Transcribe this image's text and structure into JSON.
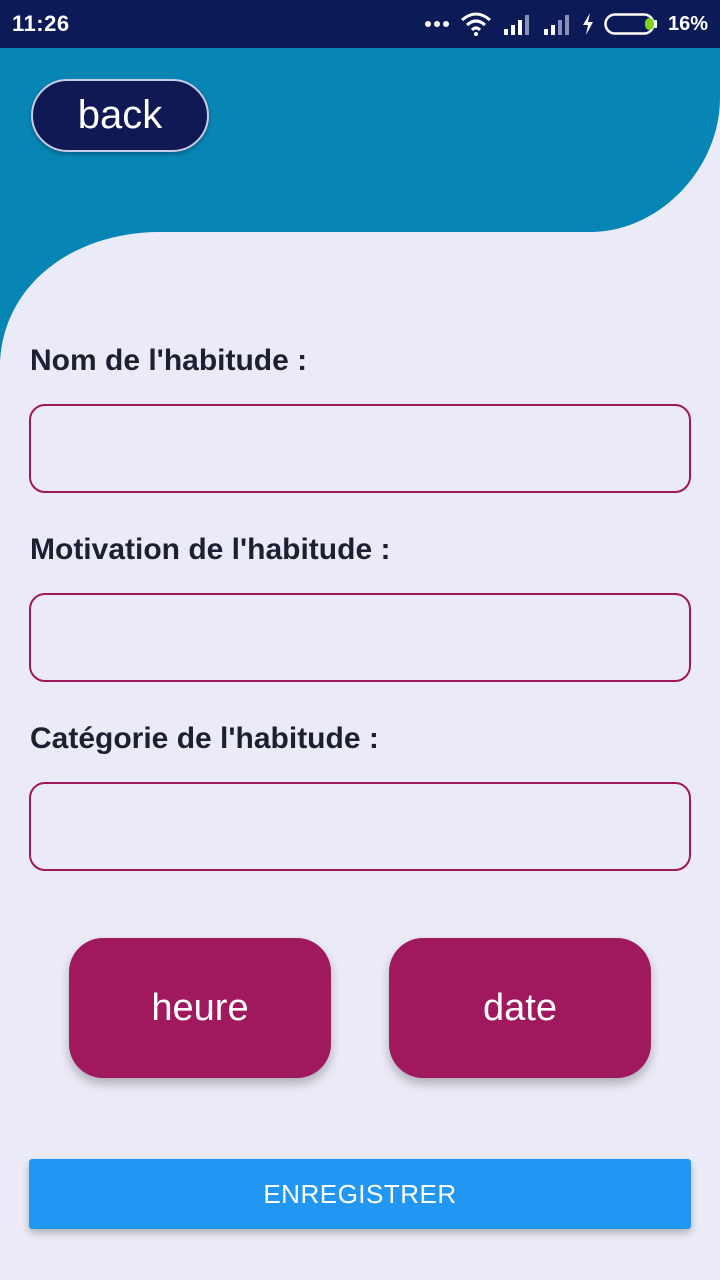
{
  "status_bar": {
    "time": "11:26",
    "battery_percent": "16%",
    "battery_level": 0.16,
    "icons": [
      "more-dots-icon",
      "wifi-icon",
      "signal-icon",
      "signal-icon-2",
      "charging-icon",
      "battery-icon"
    ]
  },
  "colors": {
    "header": "#0786b6",
    "background": "#ebebf7",
    "accent": "#a0195e",
    "primary_button": "#2196f3",
    "back_button": "#101954"
  },
  "header": {
    "back_label": "back"
  },
  "form": {
    "name_label": "Nom de l'habitude :",
    "name_value": "",
    "motivation_label": "Motivation de l'habitude :",
    "motivation_value": "",
    "category_label": "Catégorie de l'habitude :",
    "category_value": ""
  },
  "buttons": {
    "time_label": "heure",
    "date_label": "date",
    "save_label": "ENREGISTRER"
  }
}
